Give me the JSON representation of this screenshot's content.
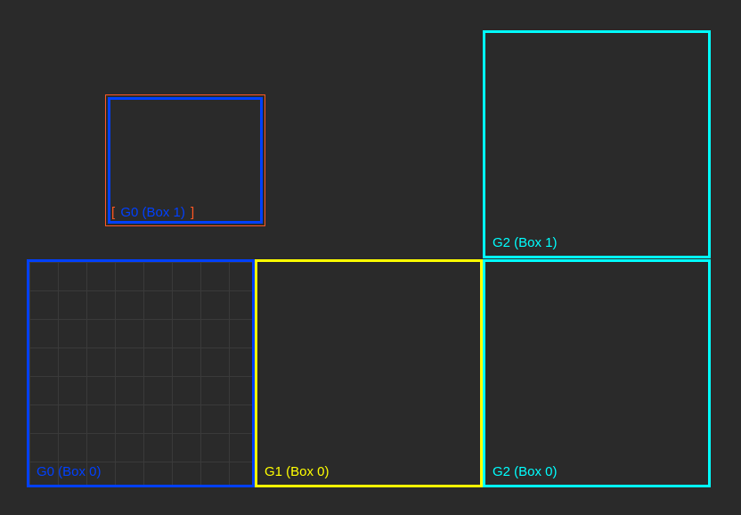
{
  "boxes": {
    "g0_box0": {
      "label": "G0 (Box 0)"
    },
    "g0_box1_outer": {
      "bracket_open": "[",
      "bracket_close": "]"
    },
    "g0_box1_inner": {
      "label": "G0 (Box 1)"
    },
    "g1_box0": {
      "label": "G1 (Box 0)"
    },
    "g2_box0": {
      "label": "G2 (Box 0)"
    },
    "g2_box1": {
      "label": "G2 (Box 1)"
    }
  }
}
